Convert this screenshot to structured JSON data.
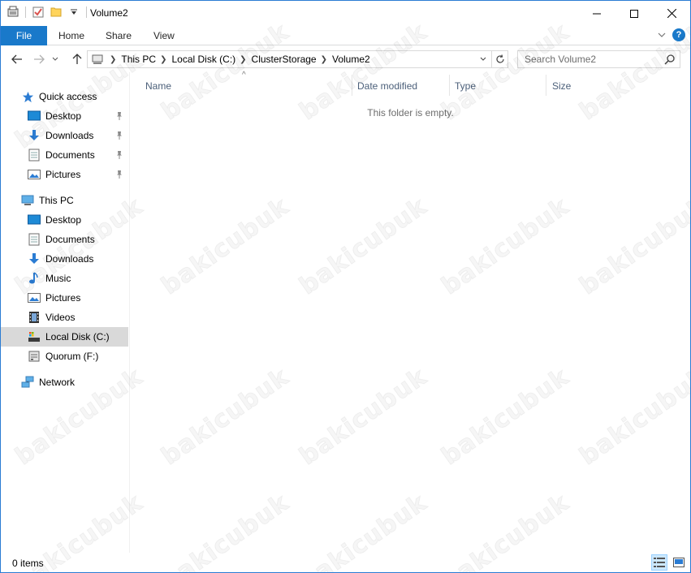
{
  "window": {
    "title": "Volume2",
    "controls": {
      "minimize": "—",
      "maximize": "☐",
      "close": "✕"
    }
  },
  "ribbon": {
    "file_label": "File",
    "tabs": [
      {
        "label": "Home"
      },
      {
        "label": "Share"
      },
      {
        "label": "View"
      }
    ],
    "help_label": "?"
  },
  "address": {
    "breadcrumbs": [
      {
        "label": "This PC"
      },
      {
        "label": "Local Disk (C:)"
      },
      {
        "label": "ClusterStorage"
      },
      {
        "label": "Volume2"
      }
    ]
  },
  "search": {
    "placeholder": "Search Volume2"
  },
  "nav": {
    "quick_access": {
      "label": "Quick access",
      "items": [
        {
          "label": "Desktop",
          "icon": "desktop-icon",
          "pinned": true
        },
        {
          "label": "Downloads",
          "icon": "downloads-icon",
          "pinned": true
        },
        {
          "label": "Documents",
          "icon": "documents-icon",
          "pinned": true
        },
        {
          "label": "Pictures",
          "icon": "pictures-icon",
          "pinned": true
        }
      ]
    },
    "this_pc": {
      "label": "This PC",
      "items": [
        {
          "label": "Desktop",
          "icon": "desktop-icon"
        },
        {
          "label": "Documents",
          "icon": "documents-icon"
        },
        {
          "label": "Downloads",
          "icon": "downloads-icon"
        },
        {
          "label": "Music",
          "icon": "music-icon"
        },
        {
          "label": "Pictures",
          "icon": "pictures-icon"
        },
        {
          "label": "Videos",
          "icon": "videos-icon"
        },
        {
          "label": "Local Disk (C:)",
          "icon": "local-disk-icon",
          "selected": true
        },
        {
          "label": "Quorum (F:)",
          "icon": "drive-icon"
        }
      ]
    },
    "network": {
      "label": "Network",
      "icon": "network-icon"
    }
  },
  "columns": {
    "name": "Name",
    "date_modified": "Date modified",
    "type": "Type",
    "size": "Size"
  },
  "content": {
    "empty_message": "This folder is empty."
  },
  "status": {
    "item_count": "0 items"
  },
  "watermark": "bakicubuk",
  "colors": {
    "accent": "#1979ca",
    "selected_bg": "#d9d9d9",
    "column_header_text": "#4c607a"
  }
}
